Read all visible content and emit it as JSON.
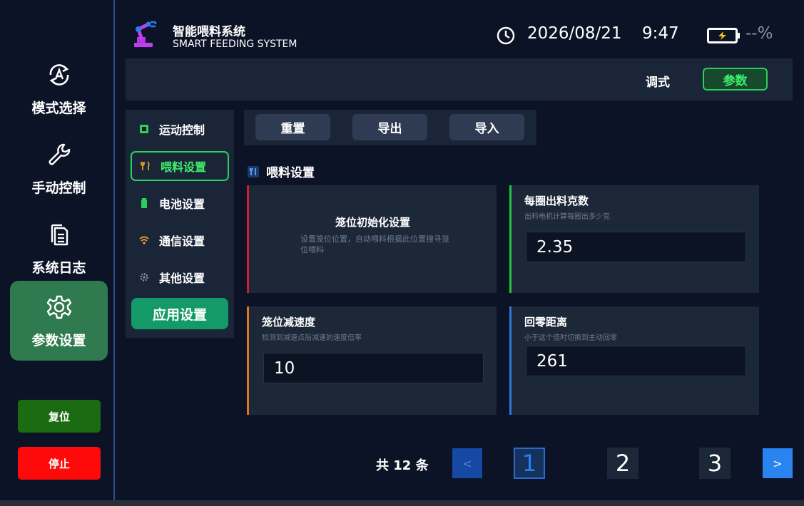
{
  "header": {
    "title": "智能喂料系统",
    "subtitle": "SMART FEEDING SYSTEM",
    "date": "2026/08/21",
    "time": "9:47",
    "battery": "--%"
  },
  "sidebar": {
    "items": [
      {
        "label": "模式选择",
        "icon": "mode-auto-icon"
      },
      {
        "label": "手动控制",
        "icon": "wrench-icon"
      },
      {
        "label": "系统日志",
        "icon": "document-icon"
      },
      {
        "label": "参数设置",
        "icon": "gear-icon",
        "active": true
      }
    ],
    "reset_label": "复位",
    "stop_label": "停止"
  },
  "modebar": {
    "debug_label": "调式",
    "param_label": "参数"
  },
  "settings_menu": {
    "items": [
      {
        "label": "运动控制",
        "icon": "chip-icon"
      },
      {
        "label": "喂料设置",
        "icon": "fork-icon",
        "active": true
      },
      {
        "label": "电池设置",
        "icon": "battery-icon"
      },
      {
        "label": "通信设置",
        "icon": "wifi-icon"
      },
      {
        "label": "其他设置",
        "icon": "cog-icon"
      }
    ],
    "apply_label": "应用设置"
  },
  "toolbar": {
    "reset_label": "重置",
    "export_label": "导出",
    "import_label": "导入"
  },
  "section": {
    "title": "喂料设置"
  },
  "cards": [
    {
      "title": "笼位初始化设置",
      "desc": "设置笼位位置，自动喂料根据此位置搜寻笼位喂料",
      "accent": "#d21e2c"
    },
    {
      "title": "每圈出料克数",
      "desc": "出料电机计算每圈出多少克",
      "value": "2.35",
      "accent": "#22c83c"
    },
    {
      "title": "笼位减速度",
      "desc": "检测到减速点后减速的速度倍率",
      "value": "10",
      "accent": "#e0761c"
    },
    {
      "title": "回零距离",
      "desc": "小于这个值时切换到主动回零",
      "value": "261",
      "accent": "#2f78d8"
    }
  ],
  "pagination": {
    "total": "共 12 条",
    "prev": "<",
    "next": ">",
    "pages": [
      "1",
      "2",
      "3"
    ],
    "current": "1"
  },
  "colors": {
    "background": "#0c1326",
    "panel": "#1b2538",
    "active_green": "#2bd05a",
    "stop_red": "#ff0a0a",
    "reset_green": "#1a6b12"
  }
}
